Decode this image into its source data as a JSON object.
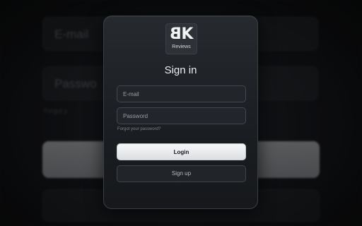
{
  "background": {
    "email_label": "E-mail",
    "password_label": "Passwo",
    "forgot_text": "Forgot y"
  },
  "logo": {
    "mark_left": "B",
    "mark_right": "K",
    "subtitle": "Reviews"
  },
  "form": {
    "title": "Sign in",
    "email_placeholder": "E-mail",
    "password_placeholder": "Password",
    "forgot_link": "Forgot your password?",
    "login_button": "Login",
    "signup_button": "Sign up"
  },
  "colors": {
    "card_background": "#1f2226",
    "login_button": "#e9ebed",
    "text": "#eceef0"
  }
}
